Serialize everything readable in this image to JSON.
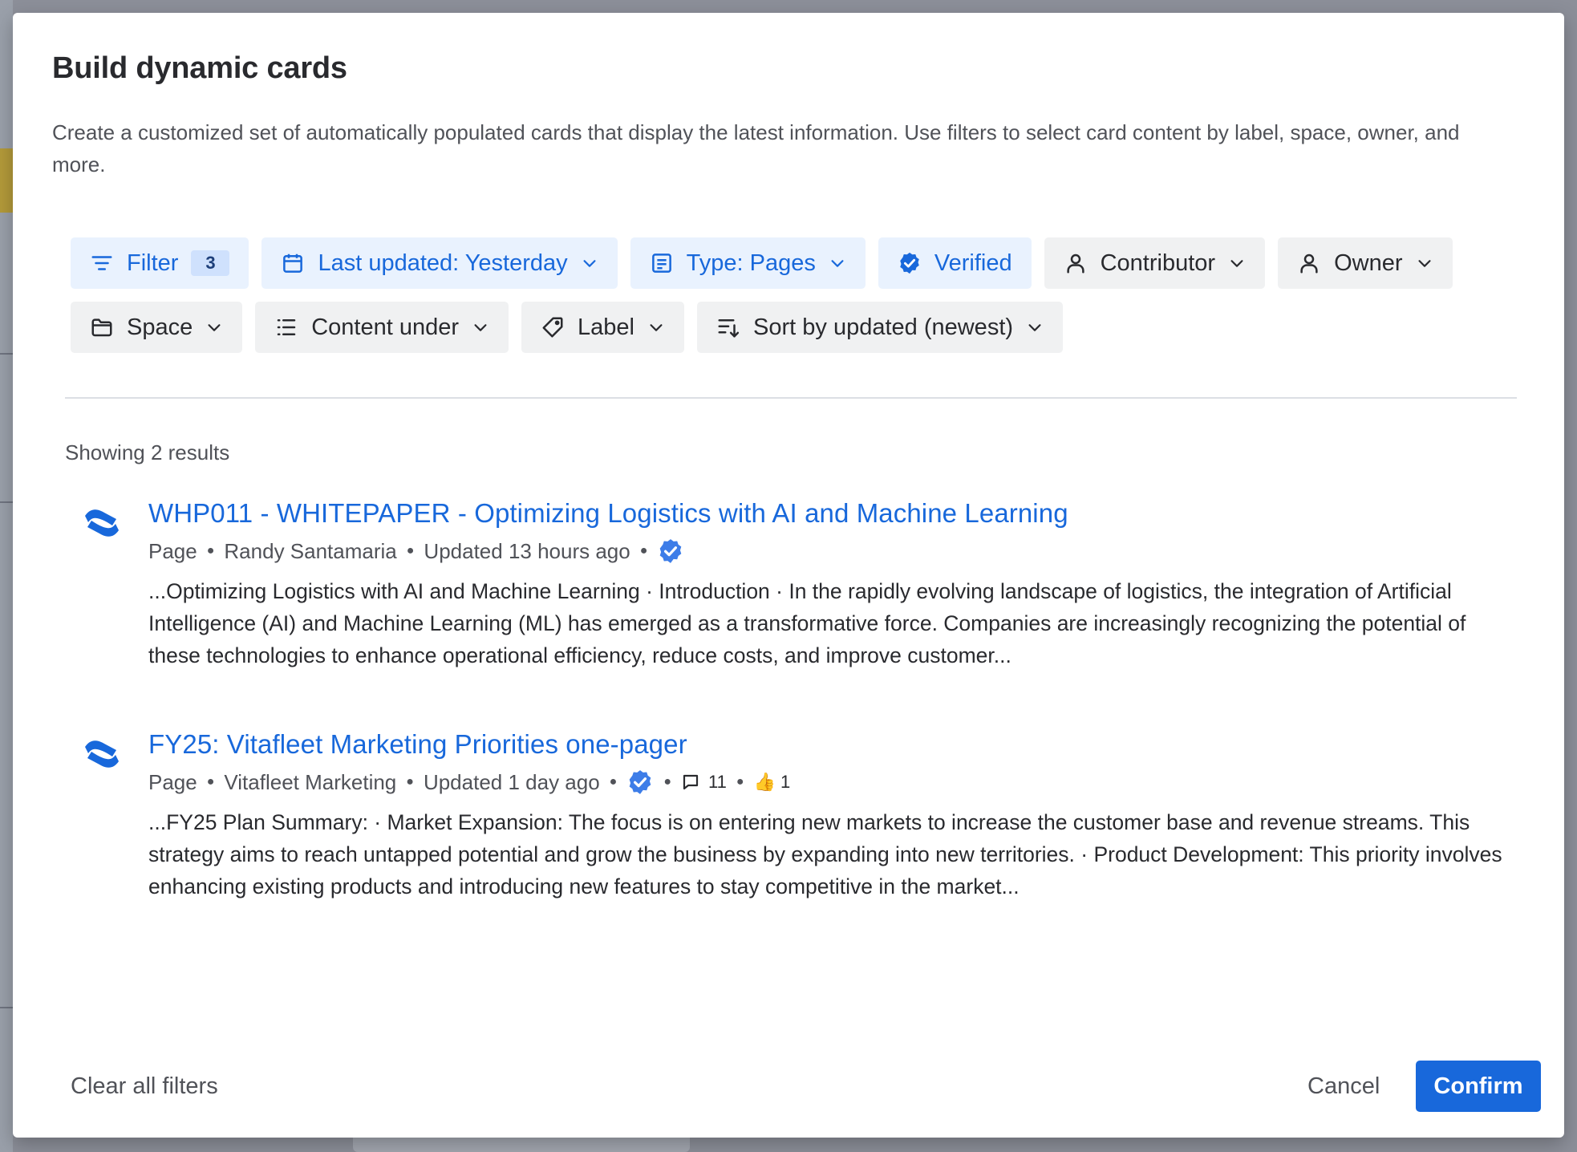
{
  "modal": {
    "title": "Build dynamic cards",
    "description": "Create a customized set of automatically populated cards that display the latest information. Use filters to select card content by label, space, owner, and more."
  },
  "filters": {
    "filter_label": "Filter",
    "filter_count": "3",
    "last_updated": "Last updated: Yesterday",
    "type": "Type: Pages",
    "verified": "Verified",
    "contributor": "Contributor",
    "owner": "Owner",
    "space": "Space",
    "content_under": "Content under",
    "label": "Label",
    "sort": "Sort by updated (newest)"
  },
  "results": {
    "count_text": "Showing 2 results",
    "items": [
      {
        "title": "WHP011 - WHITEPAPER - Optimizing Logistics with AI and Machine Learning",
        "type": "Page",
        "author": "Randy Santamaria",
        "updated": "Updated 13 hours ago",
        "excerpt": "...Optimizing Logistics with AI and Machine Learning · Introduction · In the rapidly evolving landscape of logistics, the integration of Artificial Intelligence (AI) and Machine Learning (ML) has emerged as a transformative force. Companies are increasingly recognizing the potential of these technologies to enhance operational efficiency, reduce costs, and improve customer..."
      },
      {
        "title": "FY25: Vitafleet Marketing Priorities one-pager",
        "type": "Page",
        "author": "Vitafleet Marketing",
        "updated": "Updated 1 day ago",
        "comments": "11",
        "reaction_emoji": "👍",
        "reactions": "1",
        "excerpt": "...FY25 Plan Summary: · Market Expansion: The focus is on entering new markets to increase the customer base and revenue streams. This strategy aims to reach untapped potential and grow the business by expanding into new territories. · Product Development: This priority involves enhancing existing products and introducing new features to stay competitive in the market..."
      }
    ]
  },
  "footer": {
    "clear_all": "Clear all filters",
    "cancel": "Cancel",
    "confirm": "Confirm"
  },
  "colors": {
    "brand_blue": "#1868db",
    "active_chip_bg": "#e9f2fe",
    "chip_bg": "#f0f1f2"
  },
  "icons": {
    "filter": "filter-icon",
    "calendar": "calendar-icon",
    "page": "page-icon",
    "verified": "verified-icon",
    "person": "person-icon",
    "folder": "folder-icon",
    "list": "list-icon",
    "tag": "tag-icon",
    "sort": "sort-icon",
    "chevron": "chevron-down-icon",
    "logo": "confluence-logo-icon",
    "comment": "comment-icon"
  }
}
